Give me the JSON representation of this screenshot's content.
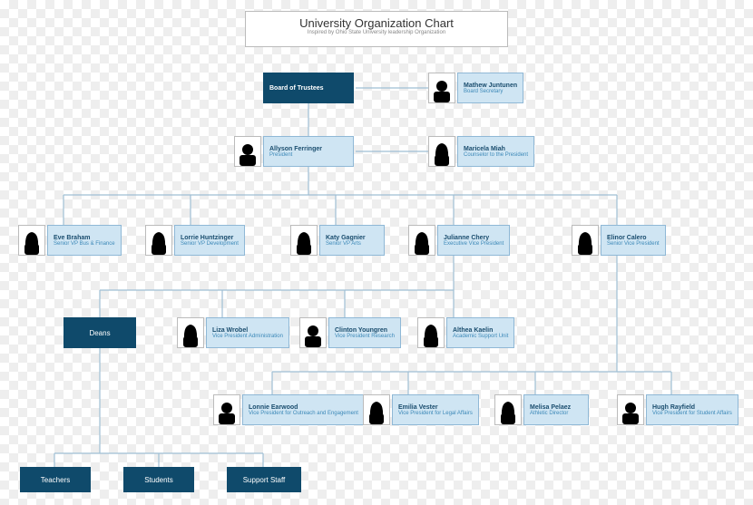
{
  "title": {
    "main": "University Organization Chart",
    "sub": "Inspired by Ohio State University leadership Organization"
  },
  "nodes": {
    "board": {
      "name": "Board of Trustees",
      "role": ""
    },
    "secretary": {
      "name": "Mathew Juntunen",
      "role": "Board Secretary"
    },
    "president": {
      "name": "Allyson Ferringer",
      "role": "President"
    },
    "counselor": {
      "name": "Maricela Miah",
      "role": "Counselor to the President"
    },
    "vp1": {
      "name": "Eve Braham",
      "role": "Senior VP Bus & Finance"
    },
    "vp2": {
      "name": "Lorrie Huntzinger",
      "role": "Senior VP Development"
    },
    "vp3": {
      "name": "Katy Gagnier",
      "role": "Senior VP Arts"
    },
    "vp4": {
      "name": "Julianne Chery",
      "role": "Executive Vice President"
    },
    "vp5": {
      "name": "Elinor Calero",
      "role": "Senior Vice President"
    },
    "deans": {
      "name": "Deans"
    },
    "sub1": {
      "name": "Liza Wrobel",
      "role": "Vice President Administration"
    },
    "sub2": {
      "name": "Clinton Youngren",
      "role": "Vice President Research"
    },
    "sub3": {
      "name": "Althea Kaelin",
      "role": "Academic Support Unit"
    },
    "low1": {
      "name": "Lonnie Earwood",
      "role": "Vice President for Outreach and Engagement"
    },
    "low2": {
      "name": "Emilia Vester",
      "role": "Vice President for Legal Affairs"
    },
    "low3": {
      "name": "Melisa Pelaez",
      "role": "Athletic Director"
    },
    "low4": {
      "name": "Hugh Rayfield",
      "role": "Vice President for Student Affairs"
    },
    "teachers": {
      "name": "Teachers"
    },
    "students": {
      "name": "Students"
    },
    "support": {
      "name": "Support Staff"
    }
  },
  "chart_data": {
    "type": "table",
    "title": "University Organization Chart",
    "hierarchy": {
      "Board of Trustees": {
        "side": [
          "Mathew Juntunen (Board Secretary)"
        ],
        "children": {
          "Allyson Ferringer (President)": {
            "side": [
              "Maricela Miah (Counselor to the President)"
            ],
            "children": {
              "Eve Braham (Senior VP Bus & Finance)": {},
              "Lorrie Huntzinger (Senior VP Development)": {},
              "Katy Gagnier (Senior VP Arts)": {},
              "Julianne Chery (Executive Vice President)": {
                "children": {
                  "Deans": {
                    "children": {
                      "Teachers": {},
                      "Students": {},
                      "Support Staff": {}
                    }
                  },
                  "Liza Wrobel (VP Administration)": {},
                  "Clinton Youngren (VP Research)": {},
                  "Althea Kaelin (Academic Support Unit)": {}
                }
              },
              "Elinor Calero (Senior Vice President)": {
                "children": {
                  "Lonnie Earwood (VP Outreach and Engagement)": {},
                  "Emilia Vester (VP Legal Affairs)": {},
                  "Melisa Pelaez (Athletic Director)": {},
                  "Hugh Rayfield (VP Student Affairs)": {}
                }
              }
            }
          }
        }
      }
    }
  }
}
